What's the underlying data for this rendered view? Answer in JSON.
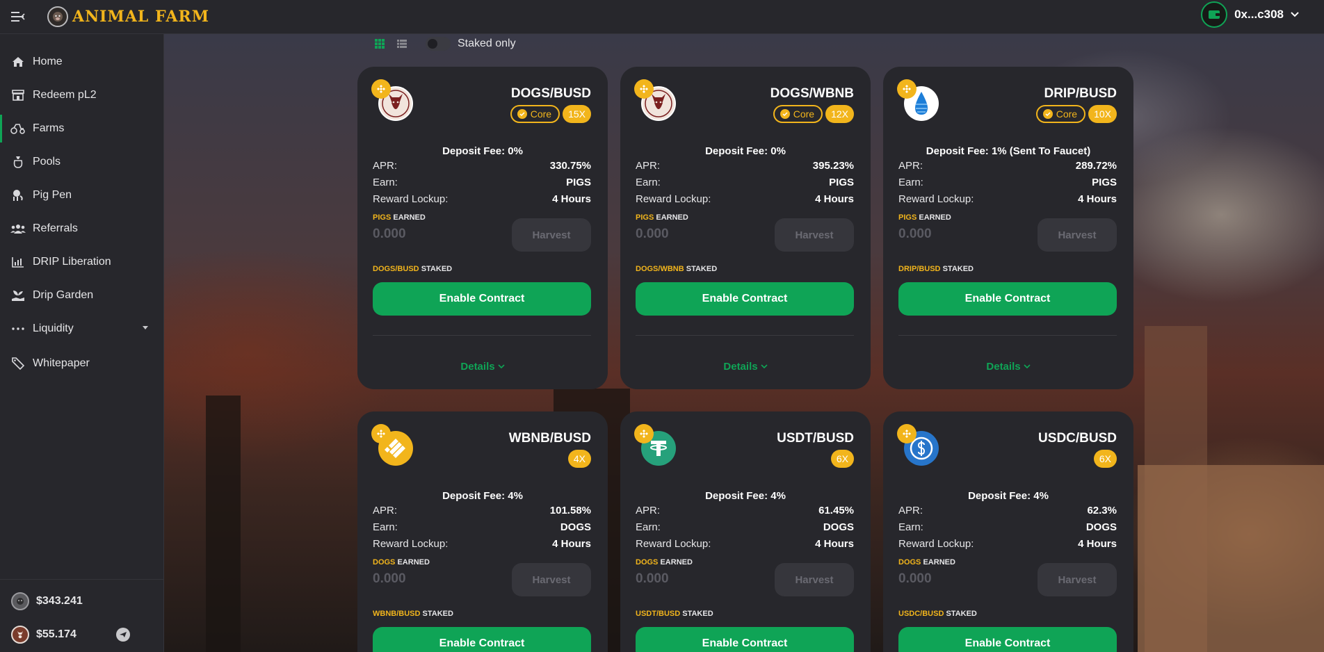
{
  "header": {
    "app_name": "ANIMAL FARM",
    "wallet_address": "0x...c308"
  },
  "sidebar": {
    "items": [
      {
        "label": "Home",
        "icon": "home-icon"
      },
      {
        "label": "Redeem pL2",
        "icon": "store-icon"
      },
      {
        "label": "Farms",
        "icon": "tractor-icon",
        "active": true
      },
      {
        "label": "Pools",
        "icon": "bag-icon"
      },
      {
        "label": "Pig Pen",
        "icon": "pig-icon"
      },
      {
        "label": "Referrals",
        "icon": "users-icon"
      },
      {
        "label": "DRIP Liberation",
        "icon": "chart-icon"
      },
      {
        "label": "Drip Garden",
        "icon": "seedling-icon"
      },
      {
        "label": "Liquidity",
        "icon": "dots-icon"
      },
      {
        "label": "Whitepaper",
        "icon": "document-icon"
      }
    ],
    "prices": [
      {
        "value": "$343.241",
        "icon": "pig-token-icon"
      },
      {
        "value": "$55.174",
        "icon": "dog-token-icon"
      }
    ]
  },
  "toolbar": {
    "staked_only_label": "Staked only"
  },
  "colors": {
    "accent_green": "#0fa456",
    "accent_yellow": "#f2b51c",
    "card_bg": "#27272c"
  },
  "farms": [
    {
      "pair": "DOGS/BUSD",
      "core_label": "Core",
      "multiplier": "15X",
      "deposit_fee": "Deposit Fee: 0%",
      "apr_label": "APR:",
      "apr": "330.75%",
      "earn_label": "Earn:",
      "earn": "PIGS",
      "lockup_label": "Reward Lockup:",
      "lockup": "4 Hours",
      "earned_token": "PIGS",
      "earned_suffix": "EARNED",
      "earned_value": "0.000",
      "harvest_label": "Harvest",
      "staked_token": "DOGS/BUSD",
      "staked_suffix": "STAKED",
      "enable_label": "Enable Contract",
      "details_label": "Details",
      "token_icon": "dog-token-icon"
    },
    {
      "pair": "DOGS/WBNB",
      "core_label": "Core",
      "multiplier": "12X",
      "deposit_fee": "Deposit Fee: 0%",
      "apr_label": "APR:",
      "apr": "395.23%",
      "earn_label": "Earn:",
      "earn": "PIGS",
      "lockup_label": "Reward Lockup:",
      "lockup": "4 Hours",
      "earned_token": "PIGS",
      "earned_suffix": "EARNED",
      "earned_value": "0.000",
      "harvest_label": "Harvest",
      "staked_token": "DOGS/WBNB",
      "staked_suffix": "STAKED",
      "enable_label": "Enable Contract",
      "details_label": "Details",
      "token_icon": "dog-token-icon"
    },
    {
      "pair": "DRIP/BUSD",
      "core_label": "Core",
      "multiplier": "10X",
      "deposit_fee": "Deposit Fee: 1% (Sent To Faucet)",
      "apr_label": "APR:",
      "apr": "289.72%",
      "earn_label": "Earn:",
      "earn": "PIGS",
      "lockup_label": "Reward Lockup:",
      "lockup": "4 Hours",
      "earned_token": "PIGS",
      "earned_suffix": "EARNED",
      "earned_value": "0.000",
      "harvest_label": "Harvest",
      "staked_token": "DRIP/BUSD",
      "staked_suffix": "STAKED",
      "enable_label": "Enable Contract",
      "details_label": "Details",
      "token_icon": "drip-token-icon"
    },
    {
      "pair": "WBNB/BUSD",
      "multiplier": "4X",
      "deposit_fee": "Deposit Fee: 4%",
      "apr_label": "APR:",
      "apr": "101.58%",
      "earn_label": "Earn:",
      "earn": "DOGS",
      "lockup_label": "Reward Lockup:",
      "lockup": "4 Hours",
      "earned_token": "DOGS",
      "earned_suffix": "EARNED",
      "earned_value": "0.000",
      "harvest_label": "Harvest",
      "staked_token": "WBNB/BUSD",
      "staked_suffix": "STAKED",
      "enable_label": "Enable Contract",
      "token_icon": "busd-token-icon"
    },
    {
      "pair": "USDT/BUSD",
      "multiplier": "6X",
      "deposit_fee": "Deposit Fee: 4%",
      "apr_label": "APR:",
      "apr": "61.45%",
      "earn_label": "Earn:",
      "earn": "DOGS",
      "lockup_label": "Reward Lockup:",
      "lockup": "4 Hours",
      "earned_token": "DOGS",
      "earned_suffix": "EARNED",
      "earned_value": "0.000",
      "harvest_label": "Harvest",
      "staked_token": "USDT/BUSD",
      "staked_suffix": "STAKED",
      "enable_label": "Enable Contract",
      "token_icon": "tether-token-icon"
    },
    {
      "pair": "USDC/BUSD",
      "multiplier": "6X",
      "deposit_fee": "Deposit Fee: 4%",
      "apr_label": "APR:",
      "apr": "62.3%",
      "earn_label": "Earn:",
      "earn": "DOGS",
      "lockup_label": "Reward Lockup:",
      "lockup": "4 Hours",
      "earned_token": "DOGS",
      "earned_suffix": "EARNED",
      "earned_value": "0.000",
      "harvest_label": "Harvest",
      "staked_token": "USDC/BUSD",
      "staked_suffix": "STAKED",
      "enable_label": "Enable Contract",
      "token_icon": "usdc-token-icon"
    }
  ]
}
